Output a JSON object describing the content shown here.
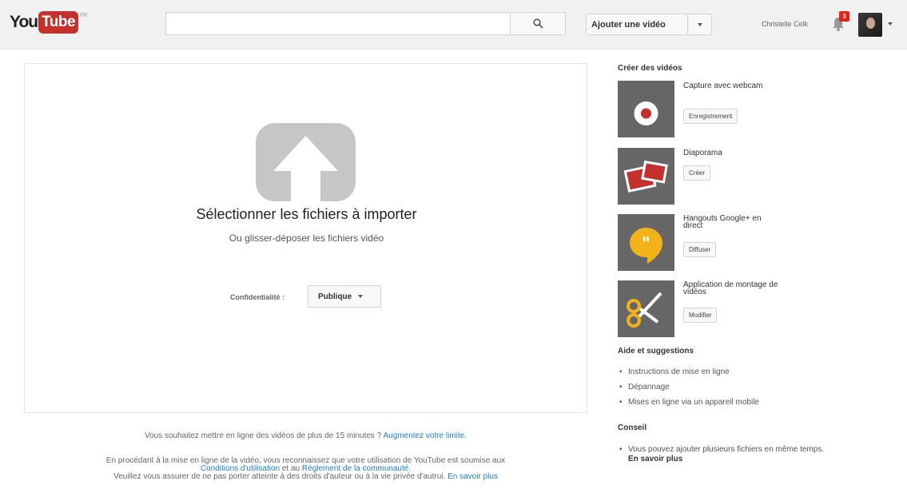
{
  "header": {
    "logo_you": "You",
    "logo_tube": "Tube",
    "logo_region": "FR",
    "search_placeholder": "",
    "upload_button": "Ajouter une vidéo",
    "username": "Christelle Celk",
    "notification_count": "3",
    "search_icon": "search-icon",
    "bell_icon": "bell-icon"
  },
  "upload": {
    "title": "Sélectionner les fichiers à importer",
    "subtitle": "Ou glisser-déposer les fichiers vidéo",
    "privacy_label": "Confidentialité :",
    "privacy_value": "Publique",
    "icon": "upload-arrow-icon"
  },
  "footer": {
    "limit_text": "Vous souhaitez mettre en ligne des vidéos de plus de 15 minutes ?",
    "limit_link": "Augmentez votre limite.",
    "terms_text_1": "En procédant à la mise en ligne de la vidéo, vous reconnaissez que votre utilisation de YouTube est soumise aux",
    "terms_link": "Conditions d'utilisation",
    "terms_and": "et au",
    "community_link": "Règlement de la communauté.",
    "rights_text": "Veuillez vous assurer de ne pas porter atteinte à des droits d'auteur ou à la vie privée d'autrui.",
    "learn_more": "En savoir plus"
  },
  "sidebar": {
    "create_heading": "Créer des vidéos",
    "tools": [
      {
        "title": "Capture avec webcam",
        "button": "Enregistrement",
        "icon": "record-icon"
      },
      {
        "title": "Diaporama",
        "button": "Créer",
        "icon": "slideshow-icon"
      },
      {
        "title": "Hangouts Google+ en direct",
        "button": "Diffuser",
        "icon": "hangouts-icon"
      },
      {
        "title": "Application de montage de vidéos",
        "button": "Modifier",
        "icon": "scissors-icon"
      }
    ],
    "help_heading": "Aide et suggestions",
    "help_items": [
      "Instructions de mise en ligne",
      "Dépannage",
      "Mises en ligne via un appareil mobile"
    ],
    "tip_heading": "Conseil",
    "tip_text": "Vous pouvez ajouter plusieurs fichiers en même temps.",
    "tip_link": "En savoir plus"
  },
  "colors": {
    "brand_red": "#c4302b",
    "link_blue": "#1b7fcc",
    "upload_icon_gray": "#c6c6c6"
  }
}
